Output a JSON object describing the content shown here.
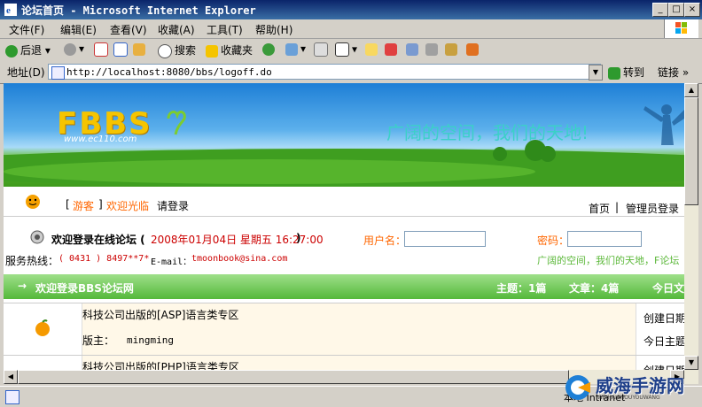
{
  "window": {
    "title": "论坛首页 - Microsoft Internet Explorer",
    "minimize": "_",
    "maximize": "□",
    "close": "×"
  },
  "menu": [
    "文件(F)",
    "编辑(E)",
    "查看(V)",
    "收藏(A)",
    "工具(T)",
    "帮助(H)"
  ],
  "toolbar": {
    "back": "后退",
    "search": "搜索",
    "favorites": "收藏夹"
  },
  "address": {
    "label": "地址(D)",
    "url": "http://localhost:8080/bbs/logoff.do",
    "go": "转到",
    "links": "链接"
  },
  "banner": {
    "logo": "FBBS",
    "logo_sub": "www.ec110.com",
    "slogan": "广阔的空间，我们的天地!"
  },
  "nav": {
    "bracket_open": "[",
    "guest": "游客",
    "bracket_close": "]",
    "welcome": "欢迎光临",
    "login": "请登录",
    "home": "首页",
    "sep": "|",
    "admin_login": "管理员登录"
  },
  "welcome": {
    "text": "欢迎登录在线论坛 (",
    "date": "2008年01月04日 星期五 16:27:00",
    "close_paren": ")",
    "username_label": "用户名：",
    "password_label": "密码：",
    "hotline_label": "服务热线：",
    "hotline_value": "( 0431 ) 8497**7* ",
    "email_label": "E-mail：",
    "email_value": "tmoonbook@sina.com",
    "tagline": "广阔的空间，我们的天地，F论坛"
  },
  "green_bar": {
    "arrow": "→",
    "title": "欢迎登录BBS论坛网",
    "topics": "主题：1篇",
    "articles": "文章：4篇",
    "today": "今日文"
  },
  "forums": [
    {
      "name": "科技公司出版的[ASP]语言类专区",
      "moderator_label": "版主：",
      "moderator": "mingming",
      "created": "创建日期",
      "today_topics": "今日主题"
    },
    {
      "name": "科技公司出版的[PHP]语言类专区",
      "created": "创建日期"
    }
  ],
  "status": {
    "zone": "本地 Intranet"
  },
  "watermark": {
    "text": "威海手游网",
    "sub": "WEIHAISHOUYOUWANG"
  },
  "colors": {
    "titlebar": "#0a246a",
    "date_red": "#cc0000",
    "orange": "#ff6600",
    "green_text": "#5cb83a",
    "green_bar": "#54b83a"
  }
}
